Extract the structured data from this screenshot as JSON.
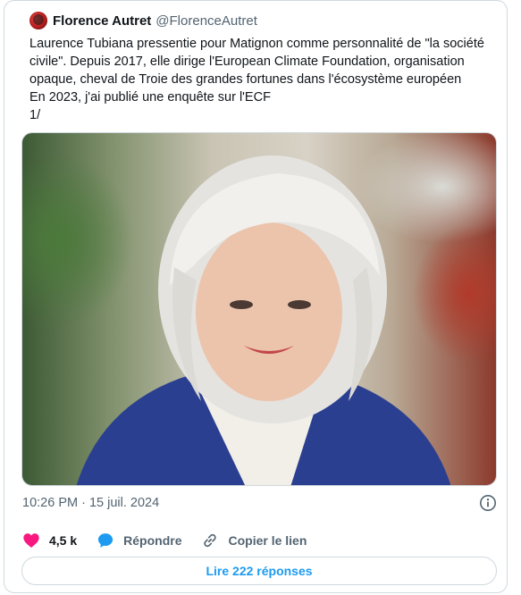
{
  "author": {
    "name": "Florence Autret",
    "handle": "@FlorenceAutret"
  },
  "tweet": {
    "lines": [
      "Laurence Tubiana pressentie pour Matignon comme personnalité de \"la société",
      "civile\". Depuis 2017, elle dirige l'European Climate Foundation, organisation",
      "opaque, cheval de Troie des grandes fortunes dans l'écosystème européen",
      "En 2023, j'ai publié une enquête sur l'ECF",
      "1/"
    ]
  },
  "meta": {
    "timestamp": "10:26 PM · 15 juil. 2024"
  },
  "actions": {
    "likes": "4,5 k",
    "reply_label": "Répondre",
    "copy_label": "Copier le lien"
  },
  "replies_button": "Lire 222 réponses",
  "icons": {
    "like": "heart-icon",
    "reply": "speech-bubble-icon",
    "copy": "link-icon",
    "info": "info-icon"
  },
  "colors": {
    "like": "#f91880",
    "reply": "#1d9bf0",
    "link": "#1d9bf0",
    "muted": "#536471",
    "border": "#cfd9de"
  }
}
